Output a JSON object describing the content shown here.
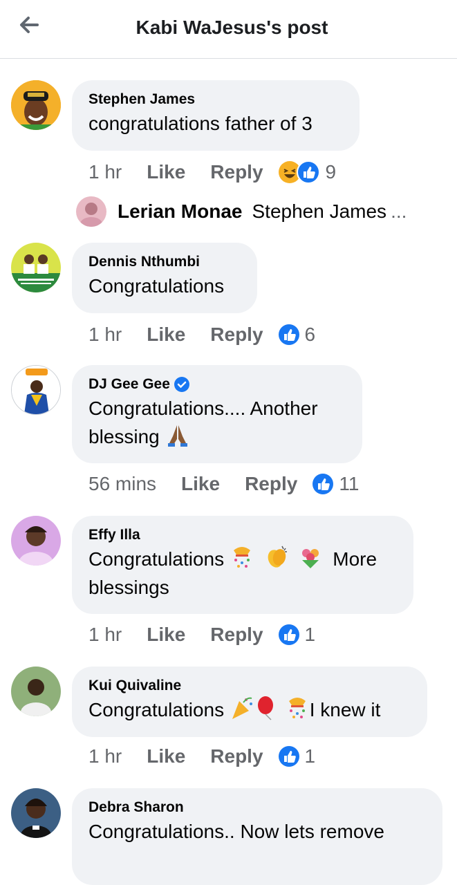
{
  "header": {
    "title": "Kabi WaJesus's post",
    "back_icon": "arrow-left-icon"
  },
  "colors": {
    "accent": "#1877f2",
    "bubble": "#f0f2f5",
    "meta": "#65676b",
    "haha": "#f7b125"
  },
  "peek": {
    "text": "[ ]"
  },
  "actions": {
    "like": "Like",
    "reply": "Reply"
  },
  "comments": [
    {
      "name": "Stephen James",
      "text": "congratulations father of 3",
      "time": "1 hr",
      "reactions": [
        "haha",
        "like"
      ],
      "reaction_count": "9"
    },
    {
      "name": "Dennis Nthumbi",
      "text": "Congratulations",
      "time": "1 hr",
      "reactions": [
        "like"
      ],
      "reaction_count": "6"
    },
    {
      "name": "DJ Gee Gee",
      "verified": true,
      "text_line1": "Congratulations.... Another",
      "text_line2": "blessing",
      "text_emoji": "folded-hands-emoji",
      "time": "56 mins",
      "reactions": [
        "like"
      ],
      "reaction_count": "11"
    },
    {
      "name": "Effy Illa",
      "text_start": "Congratulations",
      "emojis": [
        "confetti-emoji",
        "clapping-emoji",
        "bouquet-emoji"
      ],
      "text_end": "More",
      "text_line2": "blessings",
      "time": "1 hr",
      "reactions": [
        "like"
      ],
      "reaction_count": "1"
    },
    {
      "name": "Kui Quivaline",
      "text_start": "Congratulations",
      "emojis": [
        "party-popper-emoji",
        "balloon-emoji",
        "confetti-emoji"
      ],
      "text_end": "I knew it",
      "time": "1 hr",
      "reactions": [
        "like"
      ],
      "reaction_count": "1"
    },
    {
      "name": "Debra Sharon",
      "text": "Congratulations.. Now lets remove"
    }
  ],
  "reply_preview": {
    "name": "Lerian Monae",
    "text": "Stephen James",
    "more": "..."
  }
}
